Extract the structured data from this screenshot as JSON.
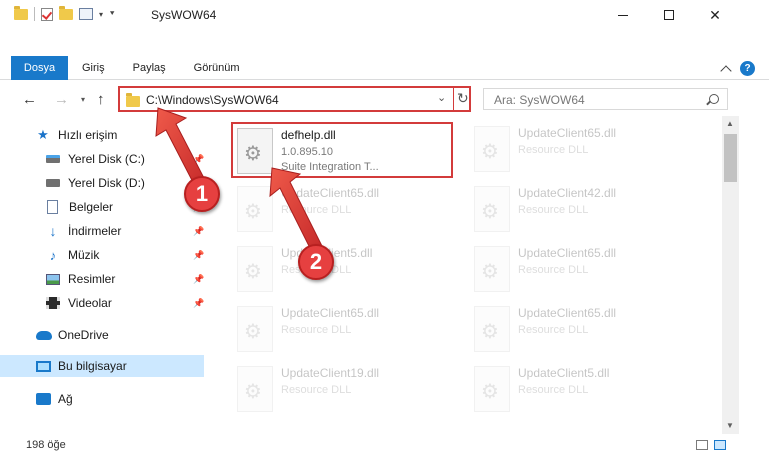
{
  "window": {
    "title": "SysWOW64"
  },
  "ribbon": {
    "tabs": [
      "Dosya",
      "Giriş",
      "Paylaş",
      "Görünüm"
    ]
  },
  "address": {
    "path": "C:\\Windows\\SysWOW64",
    "search_placeholder": "Ara: SysWOW64"
  },
  "sidebar": {
    "items": [
      {
        "label": "Hızlı erişim",
        "icon": "star-icon"
      },
      {
        "label": "Yerel Disk (C:)",
        "icon": "drive-icon"
      },
      {
        "label": "Yerel Disk (D:)",
        "icon": "drive-icon"
      },
      {
        "label": "Belgeler",
        "icon": "document-icon"
      },
      {
        "label": "İndirmeler",
        "icon": "download-icon"
      },
      {
        "label": "Müzik",
        "icon": "music-icon"
      },
      {
        "label": "Resimler",
        "icon": "pictures-icon"
      },
      {
        "label": "Videolar",
        "icon": "videos-icon"
      },
      {
        "label": "OneDrive",
        "icon": "cloud-icon"
      },
      {
        "label": "Bu bilgisayar",
        "icon": "computer-icon"
      },
      {
        "label": "Ağ",
        "icon": "network-icon"
      }
    ]
  },
  "files": [
    {
      "name": "defhelp.dll",
      "meta": "1.0.895.10",
      "desc": "Suite Integration T..."
    },
    {
      "name": "UpdateClient65.dll",
      "desc": "Resource DLL"
    },
    {
      "name": "UpdateClient65.dll",
      "desc": "Resource DLL"
    },
    {
      "name": "UpdateClient42.dll",
      "desc": "Resource DLL"
    },
    {
      "name": "UpdateClient5.dll",
      "desc": "Resource DLL"
    },
    {
      "name": "UpdateClient65.dll",
      "desc": "Resource DLL"
    },
    {
      "name": "UpdateClient65.dll",
      "desc": "Resource DLL"
    },
    {
      "name": "UpdateClient65.dll",
      "desc": "Resource DLL"
    },
    {
      "name": "UpdateClient19.dll",
      "desc": "Resource DLL"
    },
    {
      "name": "UpdateClient5.dll",
      "desc": "Resource DLL"
    }
  ],
  "status": {
    "item_count": "198 öğe"
  },
  "annotations": {
    "callout_1": "1",
    "callout_2": "2",
    "highlight_color": "#d33b3b"
  },
  "colors": {
    "accent": "#1979ca",
    "selected_bg": "#cce8ff"
  }
}
